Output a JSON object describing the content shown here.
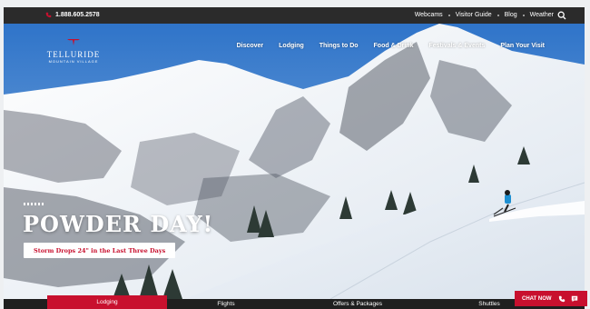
{
  "topbar": {
    "phone": "1.888.605.2578",
    "links": [
      "Webcams",
      "Visitor Guide",
      "Blog",
      "Weather"
    ]
  },
  "logo": {
    "line1": "TELLURIDE",
    "line2": "MOUNTAIN VILLAGE"
  },
  "nav": {
    "items": [
      "Discover",
      "Lodging",
      "Things to Do",
      "Food & Drink",
      "Festivals & Events",
      "Plan Your Visit"
    ]
  },
  "hero": {
    "headline": "POWDER DAY!",
    "cta_label": "Storm Drops 24\" in the Last Three Days"
  },
  "tabs": {
    "items": [
      "Lodging",
      "Flights",
      "Offers & Packages",
      "Shuttles"
    ],
    "active": "Lodging"
  },
  "chat": {
    "label": "CHAT NOW"
  },
  "colors": {
    "brand_red": "#c8102e",
    "topbar_bg": "#2b2b2b",
    "tabs_bg": "#1f1f1f"
  },
  "icons": [
    "phone-icon",
    "search-icon",
    "chat-phone-icon",
    "chat-bubble-icon"
  ]
}
